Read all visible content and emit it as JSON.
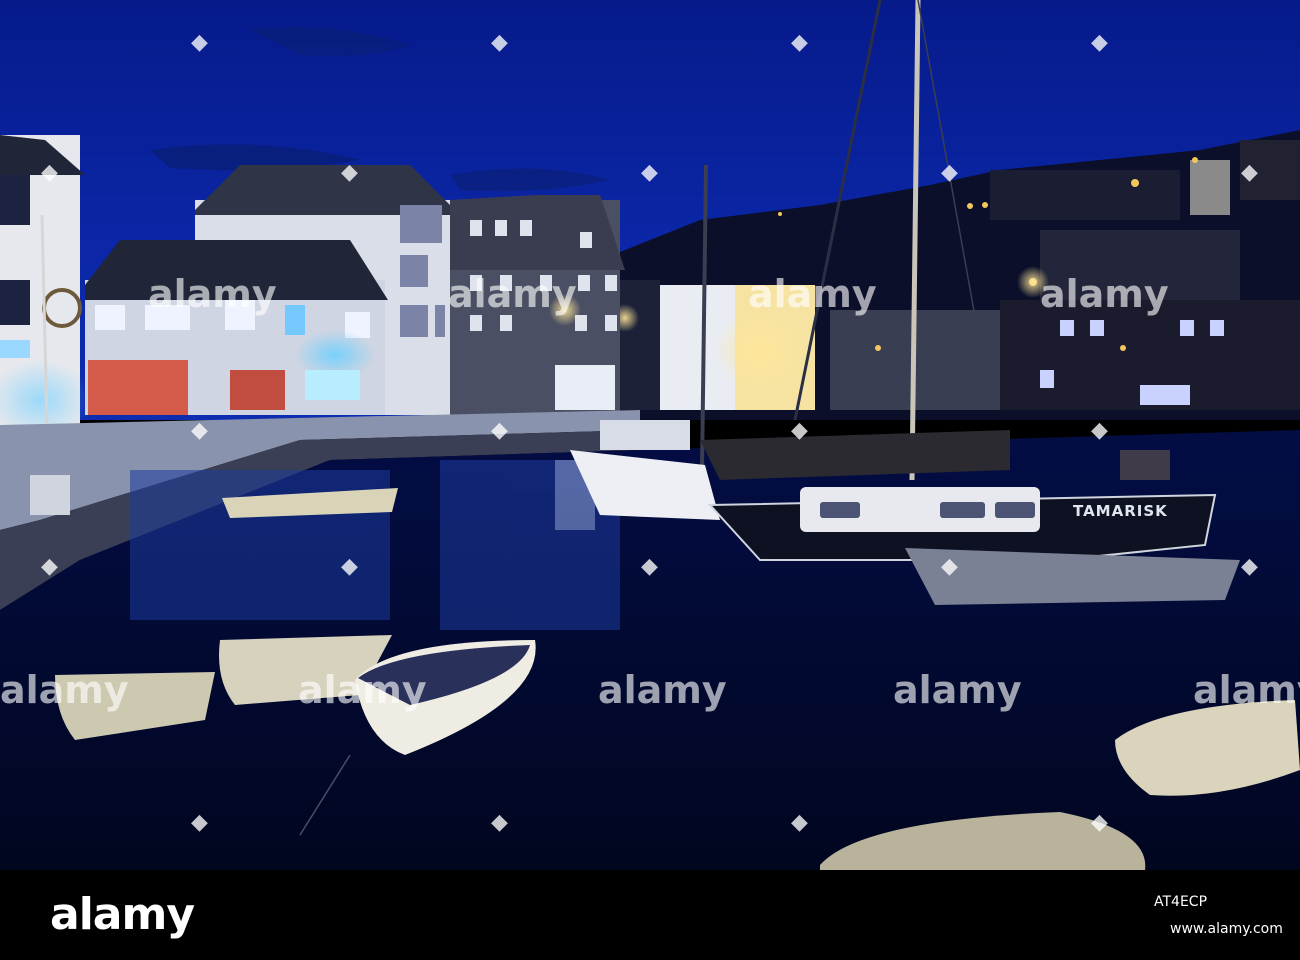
{
  "photo": {
    "boat_name": "TAMARISK",
    "colors": {
      "sky": "#0a1f8c",
      "water": "#020a3a",
      "lamp": "#f7d36b",
      "neon": "#3aa8ff"
    }
  },
  "watermark": {
    "word": "alamy",
    "icon": "diamond-icon",
    "glyph": "◆"
  },
  "footer": {
    "logo": "alamy",
    "image_id": "AT4ECP",
    "url": "www.alamy.com"
  }
}
